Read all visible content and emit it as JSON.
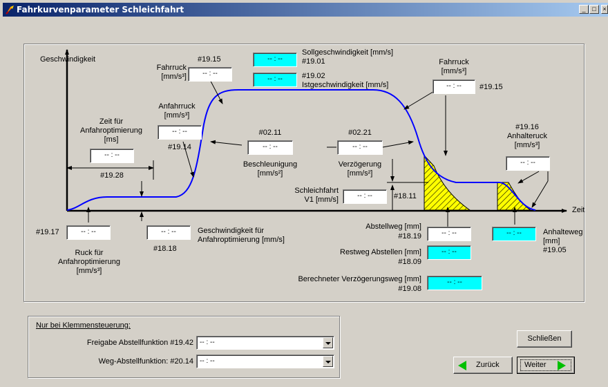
{
  "window": {
    "title": "Fahrkurvenparameter Schleichfahrt",
    "controls": [
      "_",
      "□",
      "×"
    ]
  },
  "diagram": {
    "axis_y_label": "Geschwindigkeit",
    "axis_x_label": "Zeit",
    "placeholder": "-- : --",
    "fahrruck_left": {
      "title": "Fahrruck\n[mm/s³]",
      "param": "#19.15"
    },
    "soll": {
      "label": "Sollgeschwindigkeit [mm/s]",
      "param": "#19.01"
    },
    "ist": {
      "param": "#19.02",
      "label": "Istgeschwindigkeit [mm/s]"
    },
    "fahrruck_right": {
      "title": "Fahrruck\n[mm/s³]",
      "param": "#19.15"
    },
    "anfahrruck": {
      "title": "Anfahrruck\n[mm/s³]",
      "param": "#19.14"
    },
    "zeit_anfahr": {
      "title": "Zeit für\nAnfahroptimierung\n[ms]",
      "param": "#19.28"
    },
    "beschleunigung": {
      "param": "#02.11",
      "label": "Beschleunigung\n[mm/s²]"
    },
    "verzoegerung": {
      "param": "#02.21",
      "label": "Verzögerung\n[mm/s²]"
    },
    "anhalteruck": {
      "title": "#19.16\nAnhalteruck\n[mm/s³]"
    },
    "schleichfahrt": {
      "label": "Schleichfahrt\nV1 [mm/s]",
      "param": "#18.11"
    },
    "ruck_anfahr": {
      "param": "#19.17",
      "label": "Ruck für\nAnfahroptimierung\n[mm/s³]"
    },
    "geschw_anfahr": {
      "param": "#18.18",
      "label": "Geschwindigkeit für\nAnfahroptimierung [mm/s]"
    },
    "abstellweg": {
      "label": "Abstellweg [mm]",
      "param": "#18.19"
    },
    "restweg": {
      "label": "Restweg Abstellen [mm]",
      "param": "#18.09"
    },
    "anhalteweg": {
      "label": "Anhalteweg\n[mm]\n#19.05"
    },
    "verzoegerungsweg": {
      "label": "Berechneter Verzögerungsweg [mm]",
      "param": "#19.08"
    }
  },
  "klemmen": {
    "title": "Nur bei Klemmensteuerung:",
    "freigabe_label": "Freigabe Abstellfunktion #19.42",
    "freigabe_value": "-- : --",
    "weg_label": "Weg-Abstellfunktion: #20.14",
    "weg_value": "-- : --"
  },
  "buttons": {
    "schliessen": "Schließen",
    "zurueck": "Zurück",
    "weiter": "Weiter"
  },
  "colors": {
    "curve": "#0000ff",
    "hatch_fill": "#ffff00",
    "cyan_field": "#00ffff",
    "arrow_green": "#00c000"
  }
}
